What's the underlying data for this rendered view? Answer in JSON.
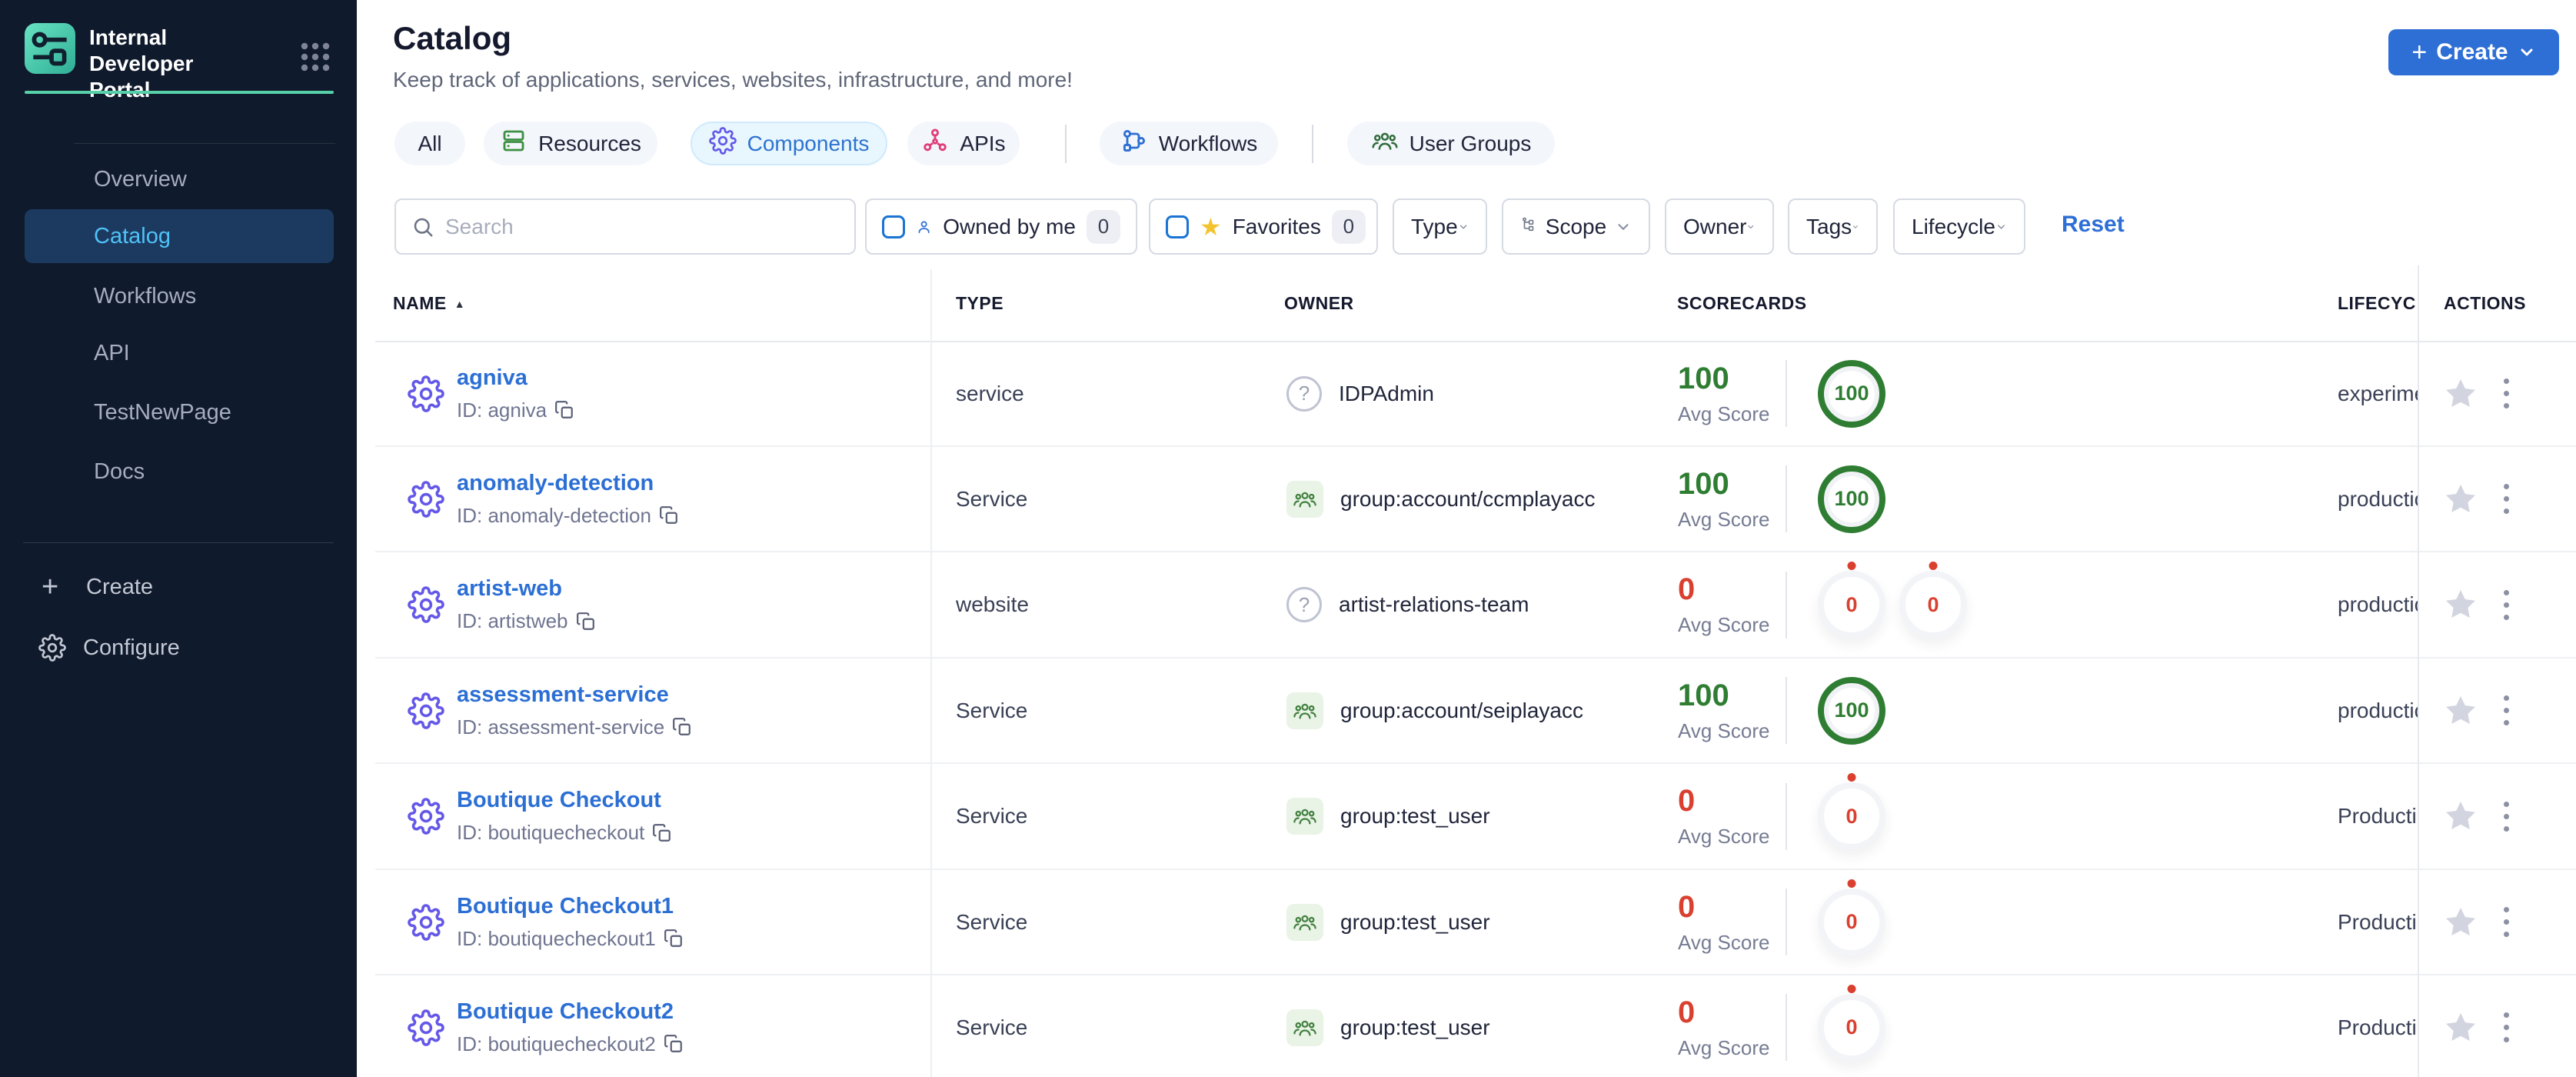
{
  "colors": {
    "accent_blue": "#2e6fd6",
    "link_blue": "#2c6fd4",
    "good_green": "#2e7d32",
    "bad_red": "#d9402f",
    "teal": "#57cfa9",
    "sidebar_bg": "#0f1a2c",
    "active_tab_bg": "#e8f6fe",
    "active_sidebar_bg": "#1c3a60",
    "active_sidebar_text": "#4fc2f8",
    "gold": "#f4c430",
    "component_indigo": "#6458e8",
    "api_pink": "#df3d7b",
    "resource_green": "#3d8f43",
    "workflow_blue": "#2d6fd2",
    "group_green": "#41803f"
  },
  "brand": {
    "title_line1": "Internal Developer",
    "title_line2": "Portal"
  },
  "sidebar": {
    "items": [
      {
        "label": "Overview"
      },
      {
        "label": "Catalog",
        "active": true
      },
      {
        "label": "Workflows"
      },
      {
        "label": "API"
      },
      {
        "label": "TestNewPage"
      },
      {
        "label": "Docs"
      }
    ],
    "create_label": "Create",
    "configure_label": "Configure"
  },
  "header": {
    "title": "Catalog",
    "subtitle": "Keep track of applications, services, websites, infrastructure, and more!",
    "create_label": "Create"
  },
  "tabs": [
    {
      "label": "All"
    },
    {
      "label": "Resources",
      "icon": "resources-icon"
    },
    {
      "label": "Components",
      "icon": "components-gear-icon",
      "active": true
    },
    {
      "label": "APIs",
      "icon": "apis-icon"
    },
    {
      "label": "Workflows",
      "icon": "workflows-icon"
    },
    {
      "label": "User Groups",
      "icon": "user-groups-icon"
    }
  ],
  "filters": {
    "search_placeholder": "Search",
    "owned_by_me": {
      "label": "Owned by me",
      "count": "0",
      "checked": false
    },
    "favorites": {
      "label": "Favorites",
      "count": "0",
      "checked": false
    },
    "dropdowns": [
      {
        "label": "Type"
      },
      {
        "label": "Scope",
        "icon": "scope-icon"
      },
      {
        "label": "Owner"
      },
      {
        "label": "Tags"
      },
      {
        "label": "Lifecycle"
      }
    ],
    "reset_label": "Reset"
  },
  "table": {
    "columns": [
      "NAME",
      "TYPE",
      "OWNER",
      "SCORECARDS",
      "LIFECYCLE",
      "ACTIONS"
    ],
    "sort_column": "NAME",
    "sort_direction": "asc",
    "avg_score_label": "Avg Score",
    "rows": [
      {
        "name": "agniva",
        "id_label": "ID: agniva",
        "type": "service",
        "owner": {
          "icon": "question",
          "label": "IDPAdmin"
        },
        "scorecard": {
          "avg": "100",
          "status": "good",
          "rings": [
            {
              "value": "100",
              "status": "good"
            }
          ]
        },
        "lifecycle": "experimental"
      },
      {
        "name": "anomaly-detection",
        "id_label": "ID: anomaly-detection",
        "type": "Service",
        "owner": {
          "icon": "group",
          "label": "group:account/ccmplayacc"
        },
        "scorecard": {
          "avg": "100",
          "status": "good",
          "rings": [
            {
              "value": "100",
              "status": "good"
            }
          ]
        },
        "lifecycle": "production"
      },
      {
        "name": "artist-web",
        "id_label": "ID: artistweb",
        "type": "website",
        "owner": {
          "icon": "question",
          "label": "artist-relations-team"
        },
        "scorecard": {
          "avg": "0",
          "status": "bad",
          "rings": [
            {
              "value": "0",
              "status": "bad"
            },
            {
              "value": "0",
              "status": "bad"
            }
          ]
        },
        "lifecycle": "production"
      },
      {
        "name": "assessment-service",
        "id_label": "ID: assessment-service",
        "type": "Service",
        "owner": {
          "icon": "group",
          "label": "group:account/seiplayacc"
        },
        "scorecard": {
          "avg": "100",
          "status": "good",
          "rings": [
            {
              "value": "100",
              "status": "good"
            }
          ]
        },
        "lifecycle": "production"
      },
      {
        "name": "Boutique Checkout",
        "id_label": "ID: boutiquecheckout",
        "type": "Service",
        "owner": {
          "icon": "group",
          "label": "group:test_user"
        },
        "scorecard": {
          "avg": "0",
          "status": "bad",
          "rings": [
            {
              "value": "0",
              "status": "bad"
            }
          ]
        },
        "lifecycle": "Production"
      },
      {
        "name": "Boutique Checkout1",
        "id_label": "ID: boutiquecheckout1",
        "type": "Service",
        "owner": {
          "icon": "group",
          "label": "group:test_user"
        },
        "scorecard": {
          "avg": "0",
          "status": "bad",
          "rings": [
            {
              "value": "0",
              "status": "bad"
            }
          ]
        },
        "lifecycle": "Production"
      },
      {
        "name": "Boutique Checkout2",
        "id_label": "ID: boutiquecheckout2",
        "type": "Service",
        "owner": {
          "icon": "group",
          "label": "group:test_user"
        },
        "scorecard": {
          "avg": "0",
          "status": "bad",
          "rings": [
            {
              "value": "0",
              "status": "bad"
            }
          ]
        },
        "lifecycle": "Production"
      }
    ]
  }
}
